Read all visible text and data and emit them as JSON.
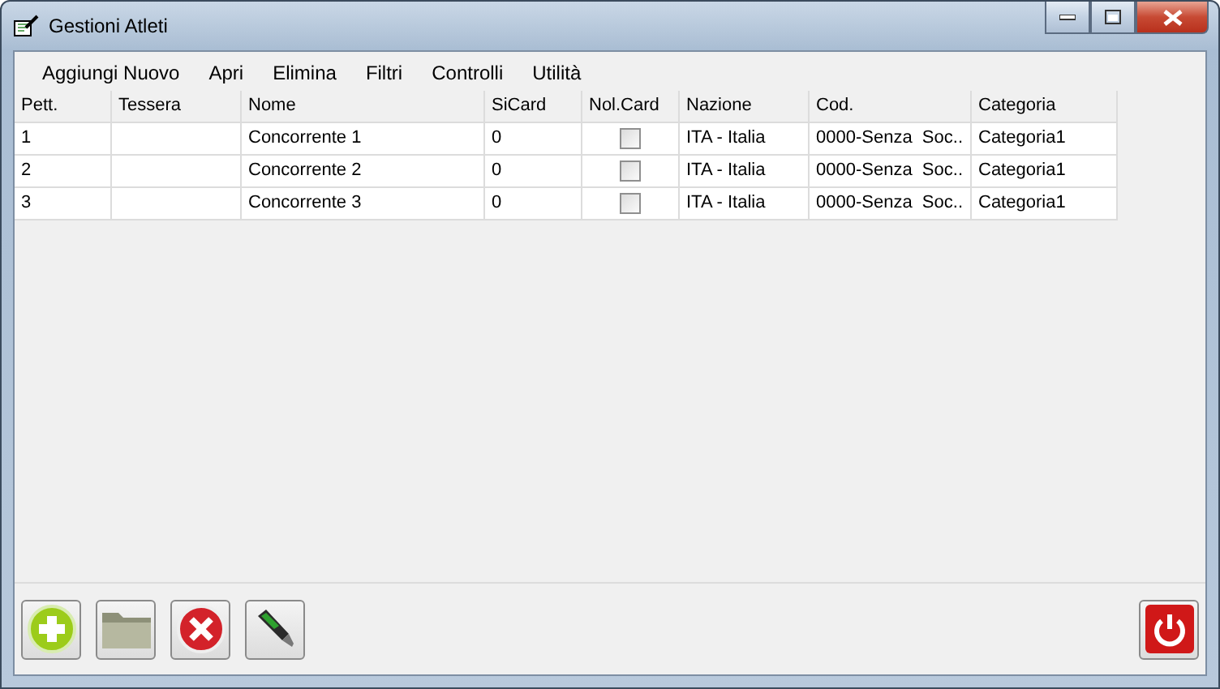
{
  "window": {
    "title": "Gestioni Atleti"
  },
  "menu": [
    "Aggiungi Nuovo",
    "Apri",
    "Elimina",
    "Filtri",
    "Controlli",
    "Utilità"
  ],
  "table": {
    "columns": [
      "Pett.",
      "Tessera",
      "Nome",
      "SiCard",
      "Nol.Card",
      "Nazione",
      "Cod.",
      "Categoria"
    ],
    "rows": [
      {
        "pett": "1",
        "tessera": "",
        "nome": "Concorrente 1",
        "sicard": "0",
        "nolcard": false,
        "nazione": "ITA - Italia",
        "cod": "0000-Senza  Soc..",
        "categoria": "Categoria1"
      },
      {
        "pett": "2",
        "tessera": "",
        "nome": "Concorrente 2",
        "sicard": "0",
        "nolcard": false,
        "nazione": "ITA - Italia",
        "cod": "0000-Senza  Soc..",
        "categoria": "Categoria1"
      },
      {
        "pett": "3",
        "tessera": "",
        "nome": "Concorrente 3",
        "sicard": "0",
        "nolcard": false,
        "nazione": "ITA - Italia",
        "cod": "0000-Senza  Soc..",
        "categoria": "Categoria1"
      }
    ]
  },
  "toolbar": [
    {
      "kind": "add"
    },
    {
      "kind": "open"
    },
    {
      "kind": "delete"
    },
    {
      "kind": "check"
    }
  ],
  "exit": {
    "kind": "power"
  }
}
